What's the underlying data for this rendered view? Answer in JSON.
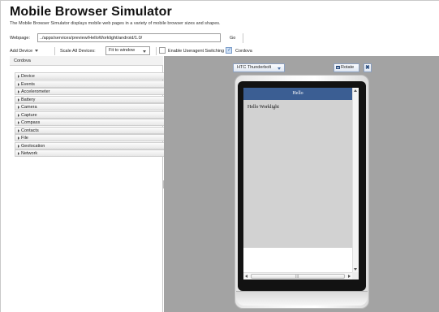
{
  "header": {
    "title": "Mobile Browser Simulator",
    "subtitle": "The Mobile Browser Simulator displays mobile web pages in a variety of mobile browser sizes and shapes."
  },
  "toolbar": {
    "webpage_label": "Webpage:",
    "url_value": "../apps/services/preview/HelloWorklight/android/1.0/",
    "go_label": "Go",
    "add_device_label": "Add Device",
    "scale_label": "Scale All Devices:",
    "scale_value": "Fit to window",
    "useragent_label": "Enable Useragent Switching",
    "useragent_checked": false,
    "cordova_label": "Cordova",
    "cordova_checked": true
  },
  "sidebar": {
    "title": "Cordova",
    "items": [
      {
        "label": "Device"
      },
      {
        "label": "Events"
      },
      {
        "label": "Accelerometer"
      },
      {
        "label": "Battery"
      },
      {
        "label": "Camera"
      },
      {
        "label": "Capture"
      },
      {
        "label": "Compass"
      },
      {
        "label": "Contacts"
      },
      {
        "label": "File"
      },
      {
        "label": "Geolocation"
      },
      {
        "label": "Network"
      }
    ]
  },
  "device": {
    "selected": "HTC Thunderbolt",
    "rotate_label": "Rotate",
    "app_header": "Hello",
    "app_text": "Hello Worklight",
    "scroll_grip": "III"
  },
  "colors": {
    "viewer_bg": "#a3a3a3",
    "app_header_bg": "#3b5e93",
    "app_content_bg": "#d2d2d2",
    "bezel": "#121212"
  },
  "icons": {
    "rotate": "rotate-icon",
    "close": "close-icon",
    "checkmark": "check-icon"
  }
}
